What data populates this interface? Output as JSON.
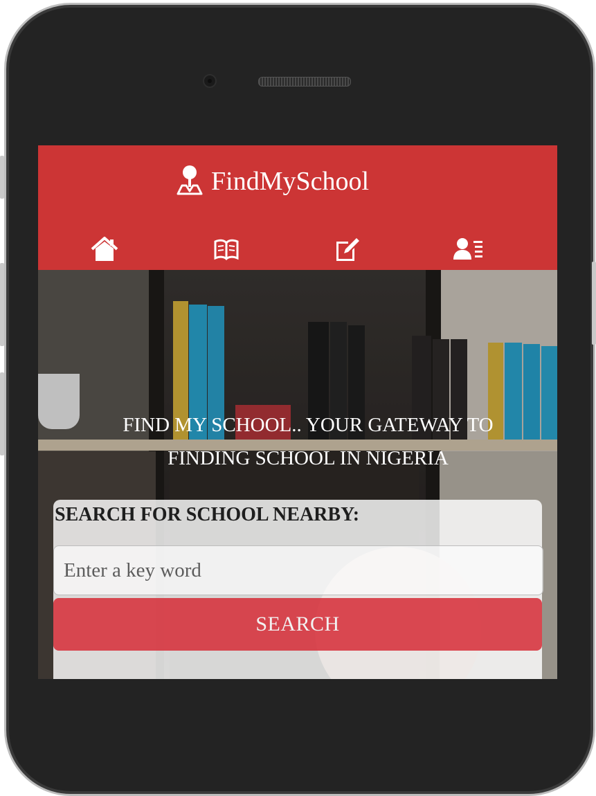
{
  "app": {
    "brand_name": "FindMySchool",
    "brand_icon": "map-pin-person-icon",
    "header_color": "#cc3535"
  },
  "nav": {
    "items": [
      {
        "icon": "home-icon"
      },
      {
        "icon": "book-icon"
      },
      {
        "icon": "edit-icon"
      },
      {
        "icon": "user-list-icon"
      }
    ]
  },
  "hero": {
    "title": "FIND MY SCHOOL.. YOUR GATEWAY TO FINDING SCHOOL IN NIGERIA"
  },
  "search": {
    "label": "SEARCH FOR SCHOOL NEARBY:",
    "placeholder": "Enter a key word",
    "value": "",
    "button_label": "SEARCH",
    "button_color": "#d62c36"
  }
}
